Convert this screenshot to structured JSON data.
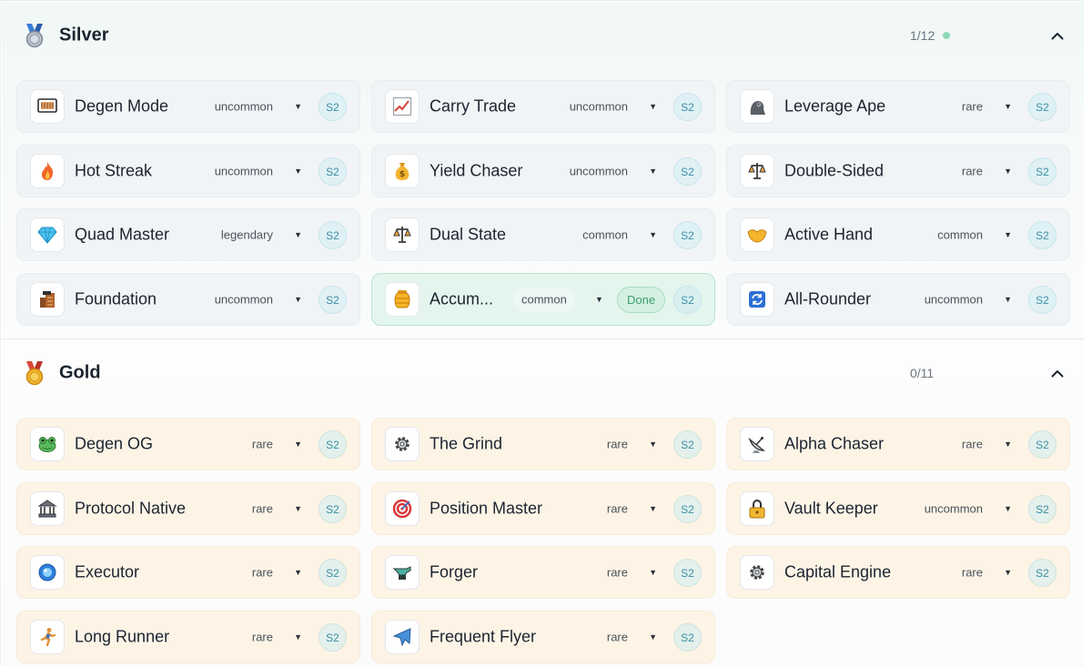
{
  "sections": [
    {
      "id": "silver",
      "title": "Silver",
      "icon": "silver-medal-icon",
      "count": "1/12",
      "status_dot_color": "#8fd9b6",
      "collapse_icon": "chevron-up-icon",
      "items": [
        {
          "name": "Degen Mode",
          "icon": "monitor-icon",
          "rarity": "uncommon",
          "season": "S2"
        },
        {
          "name": "Carry Trade",
          "icon": "chart-up-icon",
          "rarity": "uncommon",
          "season": "S2"
        },
        {
          "name": "Leverage Ape",
          "icon": "gorilla-icon",
          "rarity": "rare",
          "season": "S2"
        },
        {
          "name": "Hot Streak",
          "icon": "fire-icon",
          "rarity": "uncommon",
          "season": "S2"
        },
        {
          "name": "Yield Chaser",
          "icon": "money-bag-icon",
          "rarity": "uncommon",
          "season": "S2"
        },
        {
          "name": "Double-Sided",
          "icon": "scales-icon",
          "rarity": "rare",
          "season": "S2"
        },
        {
          "name": "Quad Master",
          "icon": "diamond-icon",
          "rarity": "legendary",
          "season": "S2"
        },
        {
          "name": "Dual State",
          "icon": "scales-icon",
          "rarity": "common",
          "season": "S2"
        },
        {
          "name": "Active Hand",
          "icon": "handshake-icon",
          "rarity": "common",
          "season": "S2"
        },
        {
          "name": "Foundation",
          "icon": "building-block-icon",
          "rarity": "uncommon",
          "season": "S2"
        },
        {
          "name": "Accum...",
          "icon": "honey-pot-icon",
          "rarity": "common",
          "season": "S2",
          "status": "Done"
        },
        {
          "name": "All-Rounder",
          "icon": "refresh-icon",
          "rarity": "uncommon",
          "season": "S2"
        }
      ]
    },
    {
      "id": "gold",
      "title": "Gold",
      "icon": "gold-medal-icon",
      "count": "0/11",
      "collapse_icon": "chevron-up-icon",
      "items": [
        {
          "name": "Degen OG",
          "icon": "frog-icon",
          "rarity": "rare",
          "season": "S2"
        },
        {
          "name": "The Grind",
          "icon": "gear-icon",
          "rarity": "rare",
          "season": "S2"
        },
        {
          "name": "Alpha Chaser",
          "icon": "satellite-dish-icon",
          "rarity": "rare",
          "season": "S2"
        },
        {
          "name": "Protocol Native",
          "icon": "bank-icon",
          "rarity": "rare",
          "season": "S2"
        },
        {
          "name": "Position Master",
          "icon": "target-icon",
          "rarity": "rare",
          "season": "S2"
        },
        {
          "name": "Vault Keeper",
          "icon": "lock-icon",
          "rarity": "uncommon",
          "season": "S2"
        },
        {
          "name": "Executor",
          "icon": "blue-orb-icon",
          "rarity": "rare",
          "season": "S2"
        },
        {
          "name": "Forger",
          "icon": "anvil-icon",
          "rarity": "rare",
          "season": "S2"
        },
        {
          "name": "Capital Engine",
          "icon": "gear-icon",
          "rarity": "rare",
          "season": "S2"
        },
        {
          "name": "Long Runner",
          "icon": "runner-icon",
          "rarity": "rare",
          "season": "S2"
        },
        {
          "name": "Frequent Flyer",
          "icon": "airplane-icon",
          "rarity": "rare",
          "season": "S2"
        }
      ]
    }
  ],
  "colors": {
    "silver_card_bg": "#f1f4f6",
    "gold_card_bg": "#fdf4e6",
    "done_card_bg": "#e4f5ee",
    "done_badge_text": "#3c9e6c",
    "season_badge_text": "#3b8fa5"
  }
}
